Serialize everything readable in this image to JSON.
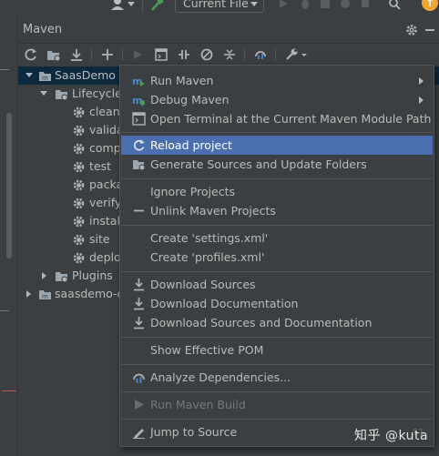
{
  "toolbar": {
    "run_config": "Current File",
    "update_badge": "↑"
  },
  "panel": {
    "title": "Maven"
  },
  "tree": {
    "project": "SaasDemo (",
    "lifecycle": "Lifecycle",
    "phases": [
      "clean",
      "valida",
      "comp",
      "test",
      "packa",
      "verify",
      "install",
      "site",
      "deplo"
    ],
    "plugins": "Plugins",
    "second_project": "saasdemo-c"
  },
  "menu": {
    "items": [
      {
        "label": "Run Maven",
        "icon": "maven-run-icon",
        "submenu": true
      },
      {
        "label": "Debug Maven",
        "icon": "maven-debug-icon",
        "submenu": true
      },
      {
        "label": "Open Terminal at the Current Maven Module Path",
        "icon": "terminal-icon"
      },
      {
        "label": "Reload project",
        "icon": "reload-icon",
        "active": true
      },
      {
        "label": "Generate Sources and Update Folders",
        "icon": "generate-sources-icon"
      },
      {
        "label": "Ignore Projects"
      },
      {
        "label": "Unlink Maven Projects",
        "icon": "minus-icon"
      },
      {
        "label": "Create 'settings.xml'"
      },
      {
        "label": "Create 'profiles.xml'"
      },
      {
        "label": "Download Sources",
        "icon": "download-icon"
      },
      {
        "label": "Download Documentation",
        "icon": "download-icon"
      },
      {
        "label": "Download Sources and Documentation",
        "icon": "download-icon"
      },
      {
        "label": "Show Effective POM"
      },
      {
        "label": "Analyze Dependencies...",
        "icon": "analyze-icon"
      },
      {
        "label": "Run Maven Build",
        "icon": "run-icon",
        "disabled": true
      },
      {
        "label": "Jump to Source",
        "icon": "edit-icon"
      }
    ]
  },
  "watermark": {
    "text": "知乎 @kuta",
    "corner": "51"
  },
  "colors": {
    "accent": "#4b6eaf",
    "selection": "#0d293e",
    "update_badge": "#f0a732"
  }
}
